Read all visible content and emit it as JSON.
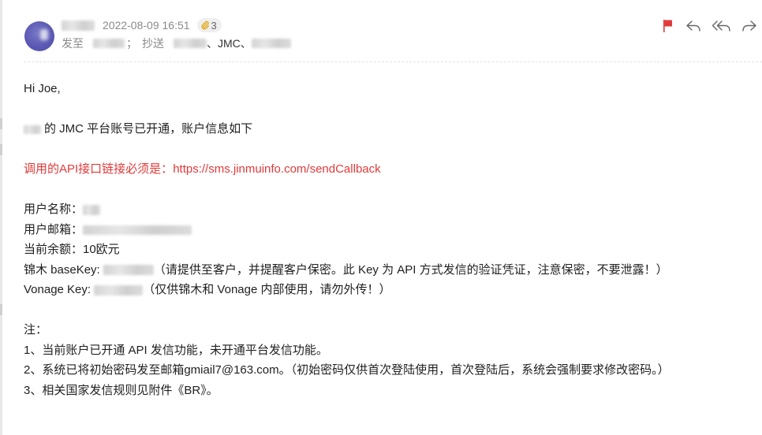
{
  "header": {
    "timestamp": "2022-08-09 16:51",
    "attachment_count": "3",
    "to_label": "发至",
    "cc_sep": "；",
    "cc_label": "抄送",
    "cc_punct1": "、",
    "cc_visible_name": "JMC",
    "cc_punct2": "、"
  },
  "actions": [
    "flag-icon",
    "reply-icon",
    "reply-all-icon",
    "forward-icon"
  ],
  "colors": {
    "flag": "#e23a3a",
    "link": "#e23a3a",
    "accent_avatar": "#5b59b3"
  },
  "body": {
    "greeting": "Hi Joe,",
    "account_opened_suffix": "的 JMC 平台账号已开通，账户信息如下",
    "api_notice_prefix": "调用的API接口链接必须是：",
    "api_url": "https://sms.jinmuinfo.com/sendCallback",
    "username_label": "用户名称：",
    "email_label": "用户邮箱：",
    "balance_line": "当前余额：10欧元",
    "basekey_label": "锦木 baseKey: ",
    "basekey_note": "（请提供至客户，并提醒客户保密。此 Key 为 API 方式发信的验证凭证，注意保密，不要泄露！）",
    "vonage_label": "Vonage Key: ",
    "vonage_note": "（仅供锦木和 Vonage 内部使用，请勿外传！）",
    "notes_title": "注：",
    "note1": "1、当前账户已开通 API 发信功能，未开通平台发信功能。",
    "note2": "2、系统已将初始密码发至邮箱gmiail7@163.com。（初始密码仅供首次登陆使用，首次登陆后，系统会强制要求修改密码。）",
    "note3": "3、相关国家发信规则见附件《BR》。"
  }
}
